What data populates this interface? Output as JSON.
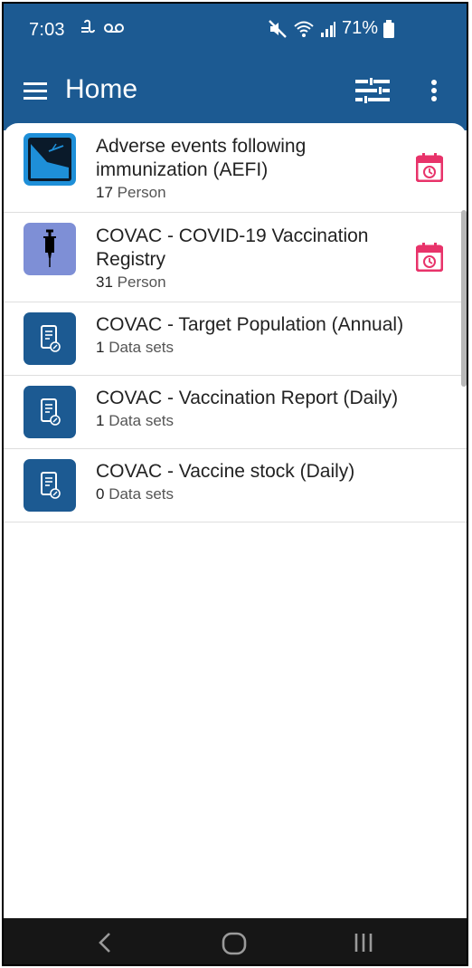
{
  "status_bar": {
    "time": "7:03",
    "left_icons": [
      "cast-icon",
      "voicemail-icon"
    ],
    "right_icons": [
      "mute-icon",
      "wifi-icon",
      "signal-icon",
      "battery-icon"
    ],
    "battery_percent": "71%"
  },
  "app_bar": {
    "title": "Home",
    "icons": [
      "menu-icon",
      "filter-icon",
      "more-vert-icon"
    ]
  },
  "programs": [
    {
      "title": "Adverse events following immunization (AEFI)",
      "count": "17",
      "unit": "Person",
      "icon": "aefi-icon",
      "has_calendar": true
    },
    {
      "title": "COVAC - COVID-19 Vaccination Registry",
      "count": "31",
      "unit": "Person",
      "icon": "syringe-icon",
      "has_calendar": true
    },
    {
      "title": "COVAC - Target Population (Annual)",
      "count": "1",
      "unit": "Data sets",
      "icon": "dataset-icon",
      "has_calendar": false
    },
    {
      "title": "COVAC - Vaccination Report (Daily)",
      "count": "1",
      "unit": "Data sets",
      "icon": "dataset-icon",
      "has_calendar": false
    },
    {
      "title": "COVAC - Vaccine stock (Daily)",
      "count": "0",
      "unit": "Data sets",
      "icon": "dataset-icon",
      "has_calendar": false
    }
  ],
  "colors": {
    "primary": "#1c5a92",
    "calendar_accent": "#e8336a",
    "syringe_bg": "#7e8fd6",
    "aefi_bg": "#1e8fd8",
    "nav_bg": "#161616"
  },
  "nav_bar": {
    "icons": [
      "back-icon",
      "home-icon",
      "recents-icon"
    ]
  }
}
